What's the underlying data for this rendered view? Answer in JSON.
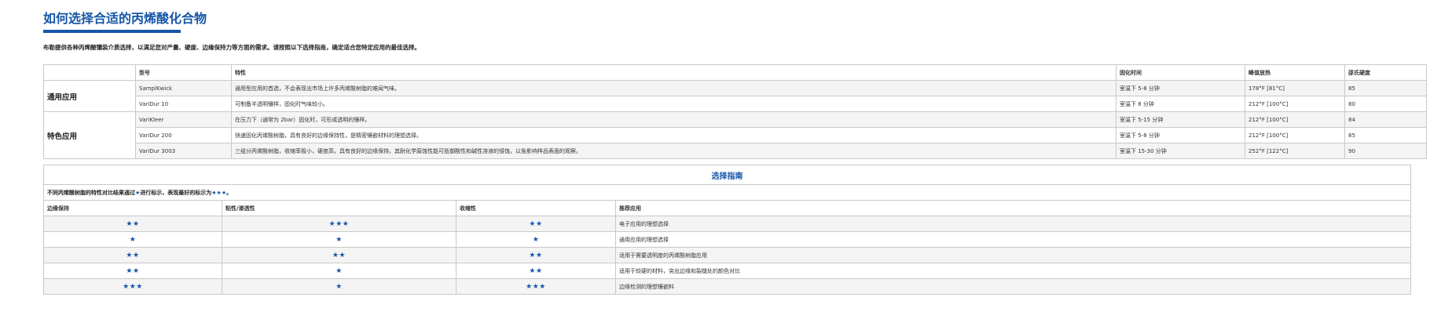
{
  "title": "如何选择合适的丙烯酸化合物",
  "intro": "布勒提供各种丙烯酸镶装介质选择，以满足您对产量、硬度、边缘保持力等方面的需求。请按照以下选择指南，确定适合您特定应用的最佳选择。",
  "products": {
    "headers": [
      "",
      "型号",
      "特性",
      "固化时间",
      "峰值放热",
      "邵氏硬度"
    ],
    "groups": [
      {
        "label": "通用应用",
        "rows": [
          {
            "model": "SamplKwick",
            "feature": "通用型应用的首选，不会表现出市场上许多丙烯酸树脂的难闻气味。",
            "cure": "室温下 5-8 分钟",
            "exotherm": "178°F [81°C]",
            "hardness": "85"
          },
          {
            "model": "VariDur 10",
            "feature": "可制备半透明镶样，固化时气味较小。",
            "cure": "室温下 8 分钟",
            "exotherm": "212°F [100°C]",
            "hardness": "80"
          }
        ]
      },
      {
        "label": "特色应用",
        "rows": [
          {
            "model": "VariKleer",
            "feature": "在压力下（通常为 2bar）固化时，可形成透明的镶样。",
            "cure": "室温下 5-15 分钟",
            "exotherm": "212°F [100°C]",
            "hardness": "84"
          },
          {
            "model": "VariDur 200",
            "feature": "快速固化丙烯酸树脂，具有良好的边缘保持性，是精密镶嵌材料的理想选择。",
            "cure": "室温下 5-8 分钟",
            "exotherm": "212°F [100°C]",
            "hardness": "85"
          },
          {
            "model": "VariDur 3003",
            "feature": "三组分丙烯酸树脂，收缩率极小，硬度高，具有良好的边缘保持。其耐化学腐蚀性能可抵御酸性和碱性溶液的侵蚀，以免影响样品表面的观察。",
            "cure": "室温下 15-30 分钟",
            "exotherm": "252°F [122°C]",
            "hardness": "90"
          }
        ]
      }
    ]
  },
  "guide": {
    "title": "选择指南",
    "note_prefix": "不同丙烯酸树脂的特性对比结果通过",
    "note_star": "★",
    "note_middle": "进行标示，表现最好的标示为",
    "note_best": "★★★",
    "note_end": "。",
    "headers": [
      "边缘保持",
      "粘性/渗透性",
      "收缩性",
      "推荐应用"
    ],
    "rows": [
      {
        "edge": "★★",
        "viscosity": "★★★",
        "shrink": "★★",
        "application": "电子应用的理想选择"
      },
      {
        "edge": "★",
        "viscosity": "★",
        "shrink": "★",
        "application": "通用应用的理想选择"
      },
      {
        "edge": "★★",
        "viscosity": "★★",
        "shrink": "★★",
        "application": "适用于需要透明度的丙烯酸树脂应用"
      },
      {
        "edge": "★★",
        "viscosity": "★",
        "shrink": "★★",
        "application": "适用于较硬的材料，突出边缘和裂缝处的颜色对比"
      },
      {
        "edge": "★★★",
        "viscosity": "★",
        "shrink": "★★★",
        "application": "边缘检测的理想镶嵌料"
      }
    ]
  },
  "colors": {
    "accent": "#1556a8",
    "border": "#c9c9c9",
    "row_alt": "#f4f4f4"
  }
}
